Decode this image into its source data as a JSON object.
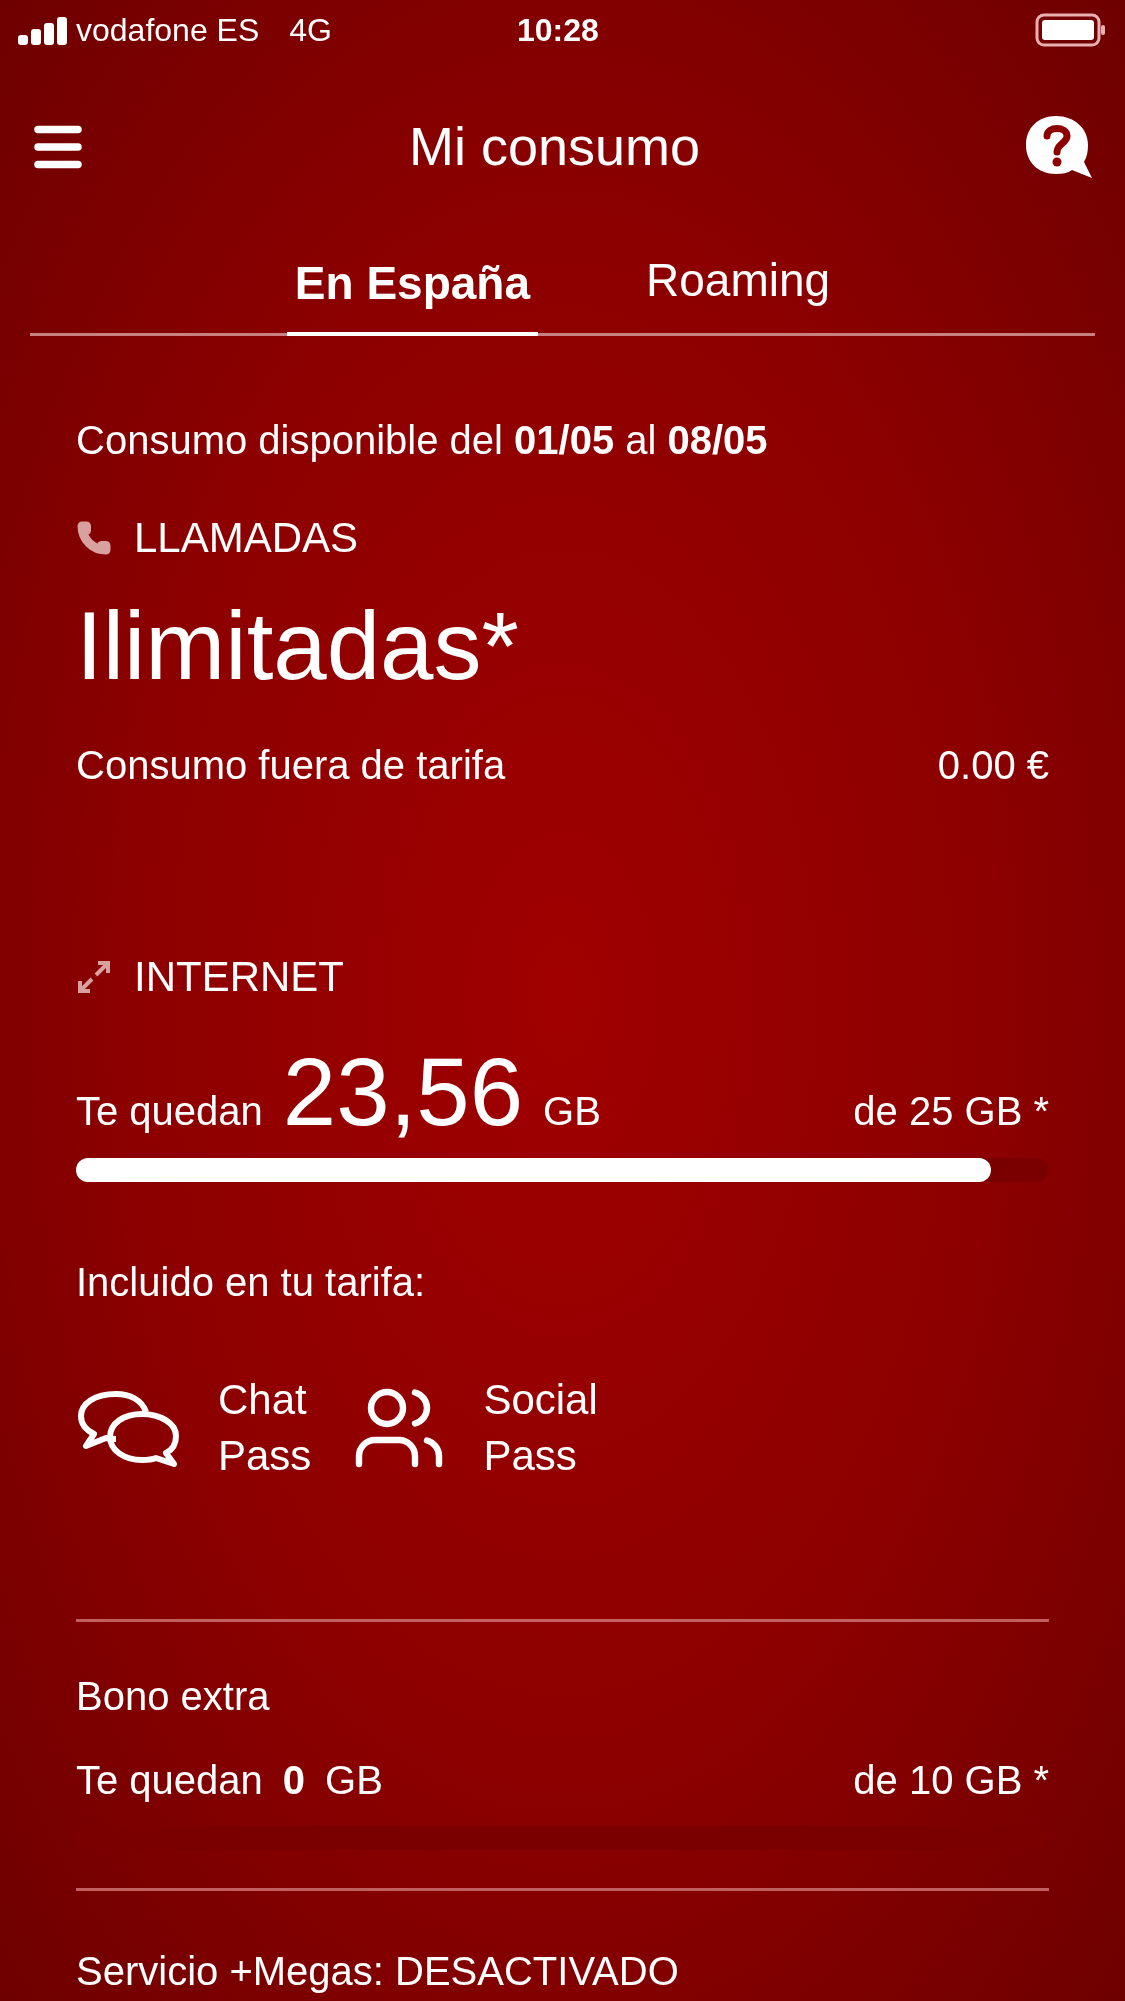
{
  "status_bar": {
    "carrier": "vodafone ES",
    "network": "4G",
    "time": "10:28"
  },
  "header": {
    "title": "Mi consumo"
  },
  "tabs": [
    {
      "label": "En España",
      "selected": true
    },
    {
      "label": "Roaming",
      "selected": false
    }
  ],
  "period": "Consumo disponible del **01/05** al **08/05**",
  "calls": {
    "heading": "LLAMADAS",
    "value": "Ilimitadas*",
    "extra_label": "Consumo fuera de tarifa",
    "extra_value": "0.00 €"
  },
  "internet": {
    "heading": "INTERNET",
    "prefix": "Te quedan",
    "amount": "23,56",
    "unit": "GB",
    "total": "de 25 GB *",
    "level": 0.94
  },
  "included": {
    "title": "Incluido en tu tarifa:",
    "passes": [
      {
        "kind": "chat",
        "name": "Chat",
        "sub": "Pass"
      },
      {
        "kind": "social",
        "name": "Social",
        "sub": "Pass"
      }
    ]
  },
  "bonus": {
    "title": "Bono extra",
    "prefix": "Te quedan",
    "amount": "0",
    "unit": "GB",
    "total": "de 10 GB *"
  },
  "service": "Servicio +Megas: DESACTIVADO"
}
